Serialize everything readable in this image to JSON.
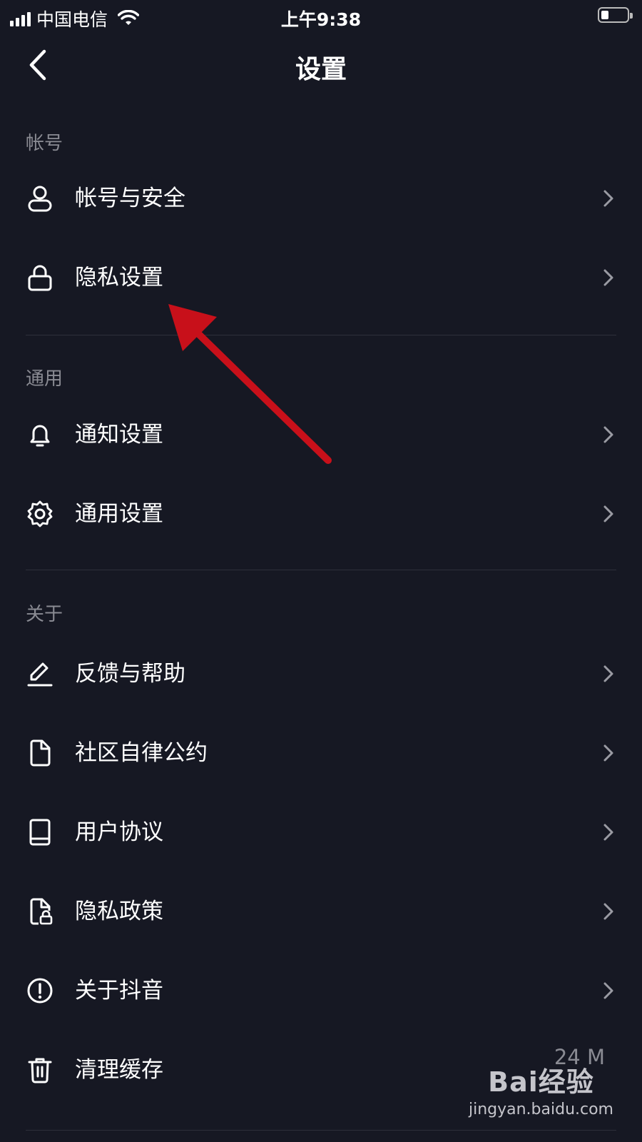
{
  "status_bar": {
    "carrier": "中国电信",
    "time": "上午9:38"
  },
  "navbar": {
    "title": "设置"
  },
  "sections": [
    {
      "header": "帐号",
      "items": [
        {
          "label": "帐号与安全",
          "icon": "user-icon"
        },
        {
          "label": "隐私设置",
          "icon": "lock-icon"
        }
      ]
    },
    {
      "header": "通用",
      "items": [
        {
          "label": "通知设置",
          "icon": "bell-icon"
        },
        {
          "label": "通用设置",
          "icon": "gear-icon"
        }
      ]
    },
    {
      "header": "关于",
      "items": [
        {
          "label": "反馈与帮助",
          "icon": "pencil-icon"
        },
        {
          "label": "社区自律公约",
          "icon": "document-icon"
        },
        {
          "label": "用户协议",
          "icon": "book-icon"
        },
        {
          "label": "隐私政策",
          "icon": "document-lock-icon"
        },
        {
          "label": "关于抖音",
          "icon": "exclamation-circle-icon"
        },
        {
          "label": "清理缓存",
          "icon": "trash-icon",
          "value": "24 M"
        }
      ]
    }
  ],
  "annotation": {
    "color": "#c8101a",
    "points_to": "隐私设置"
  },
  "watermark": {
    "brand": "Bai经验",
    "url": "jingyan.baidu.com"
  },
  "colors": {
    "background": "#161823",
    "text": "#ffffff",
    "secondary_text": "#8a8b93",
    "divider": "#2d2f3a"
  }
}
